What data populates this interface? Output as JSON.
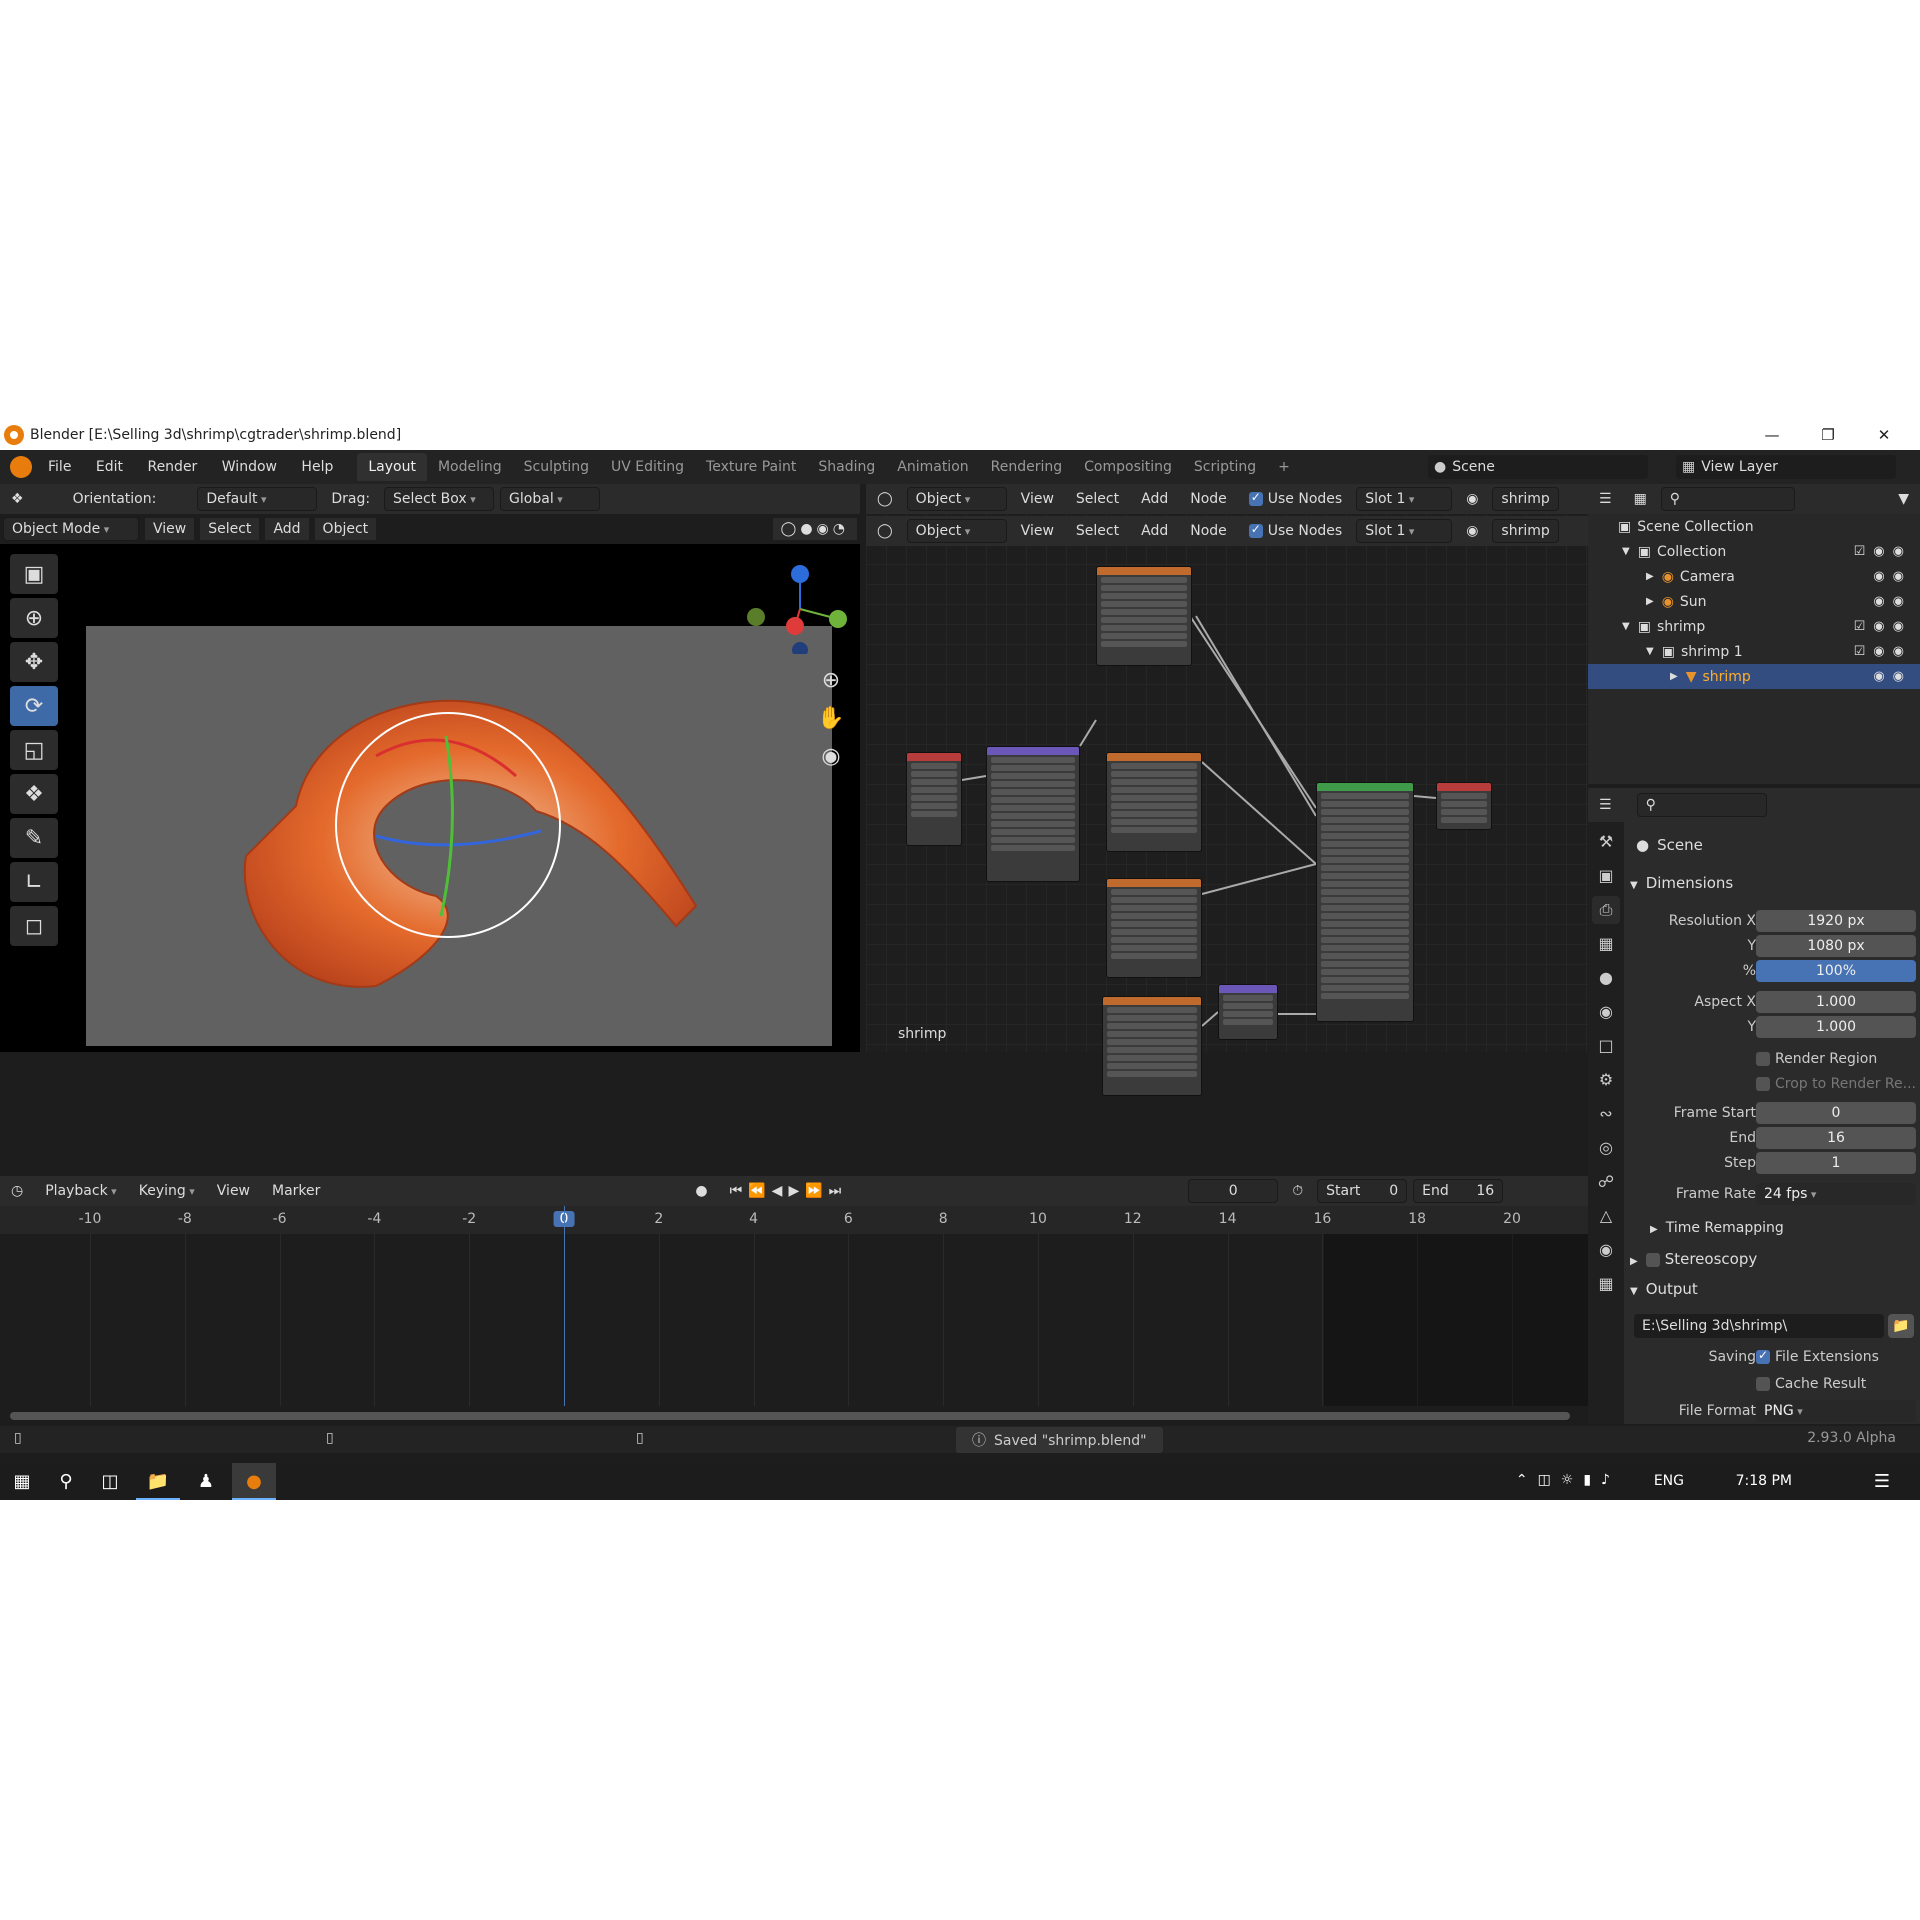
{
  "window": {
    "title": "Blender [E:\\Selling 3d\\shrimp\\cgtrader\\shrimp.blend]"
  },
  "menus": [
    "File",
    "Edit",
    "Render",
    "Window",
    "Help"
  ],
  "workspaces": [
    "Layout",
    "Modeling",
    "Sculpting",
    "UV Editing",
    "Texture Paint",
    "Shading",
    "Animation",
    "Rendering",
    "Compositing",
    "Scripting"
  ],
  "active_workspace": "Layout",
  "scene": {
    "label": "Scene",
    "view_layer": "View Layer"
  },
  "viewport_header": {
    "orientation_label": "Orientation:",
    "orientation_value": "Default",
    "drag_label": "Drag:",
    "drag_value": "Select Box",
    "transform_value": "Global",
    "mode": "Object Mode",
    "menus": [
      "View",
      "Select",
      "Add",
      "Object"
    ]
  },
  "node_header": {
    "object": "Object",
    "menus": [
      "View",
      "Select",
      "Add",
      "Node"
    ],
    "use_nodes": "Use Nodes",
    "slot": "Slot 1",
    "material": "shrimp"
  },
  "node_editor": {
    "material_label": "shrimp"
  },
  "outliner": {
    "rows": [
      {
        "label": "Scene Collection",
        "indent": 0
      },
      {
        "label": "Collection",
        "indent": 1
      },
      {
        "label": "Camera",
        "indent": 2
      },
      {
        "label": "Sun",
        "indent": 2
      },
      {
        "label": "shrimp",
        "indent": 1
      },
      {
        "label": "shrimp 1",
        "indent": 2
      },
      {
        "label": "shrimp",
        "indent": 3,
        "selected": true
      }
    ]
  },
  "properties": {
    "context": "Scene",
    "dimensions": {
      "title": "Dimensions",
      "resolution_x_label": "Resolution X",
      "resolution_x": "1920 px",
      "y_label": "Y",
      "resolution_y": "1080 px",
      "percent_label": "%",
      "percent": "100%",
      "aspect_x_label": "Aspect X",
      "aspect_x": "1.000",
      "aspect_y": "1.000",
      "render_region": "Render Region",
      "crop": "Crop to Render Re...",
      "frame_start_label": "Frame Start",
      "frame_start": "0",
      "end_label": "End",
      "end": "16",
      "step_label": "Step",
      "step": "1",
      "frame_rate_label": "Frame Rate",
      "frame_rate": "24 fps",
      "time_remapping": "Time Remapping"
    },
    "stereoscopy": "Stereoscopy",
    "output": {
      "title": "Output",
      "path": "E:\\Selling 3d\\shrimp\\",
      "saving_label": "Saving",
      "file_extensions": "File Extensions",
      "cache_result": "Cache Result",
      "file_format_label": "File Format",
      "file_format": "PNG"
    }
  },
  "timeline": {
    "menus": [
      "Playback",
      "Keying",
      "View",
      "Marker"
    ],
    "current_frame": "0",
    "start_label": "Start",
    "start": "0",
    "end_label": "End",
    "end": "16",
    "ticks": [
      "-10",
      "-8",
      "-6",
      "-4",
      "-2",
      "0",
      "2",
      "4",
      "6",
      "8",
      "10",
      "12",
      "14",
      "16",
      "18",
      "20"
    ]
  },
  "status": {
    "message": "Saved \"shrimp.blend\"",
    "version": "2.93.0 Alpha"
  },
  "taskbar": {
    "lang": "ENG",
    "time": "7:18 PM"
  },
  "colors": {
    "accent": "#4772b3",
    "selected": "#334d80",
    "orange": "#e87d0d"
  }
}
